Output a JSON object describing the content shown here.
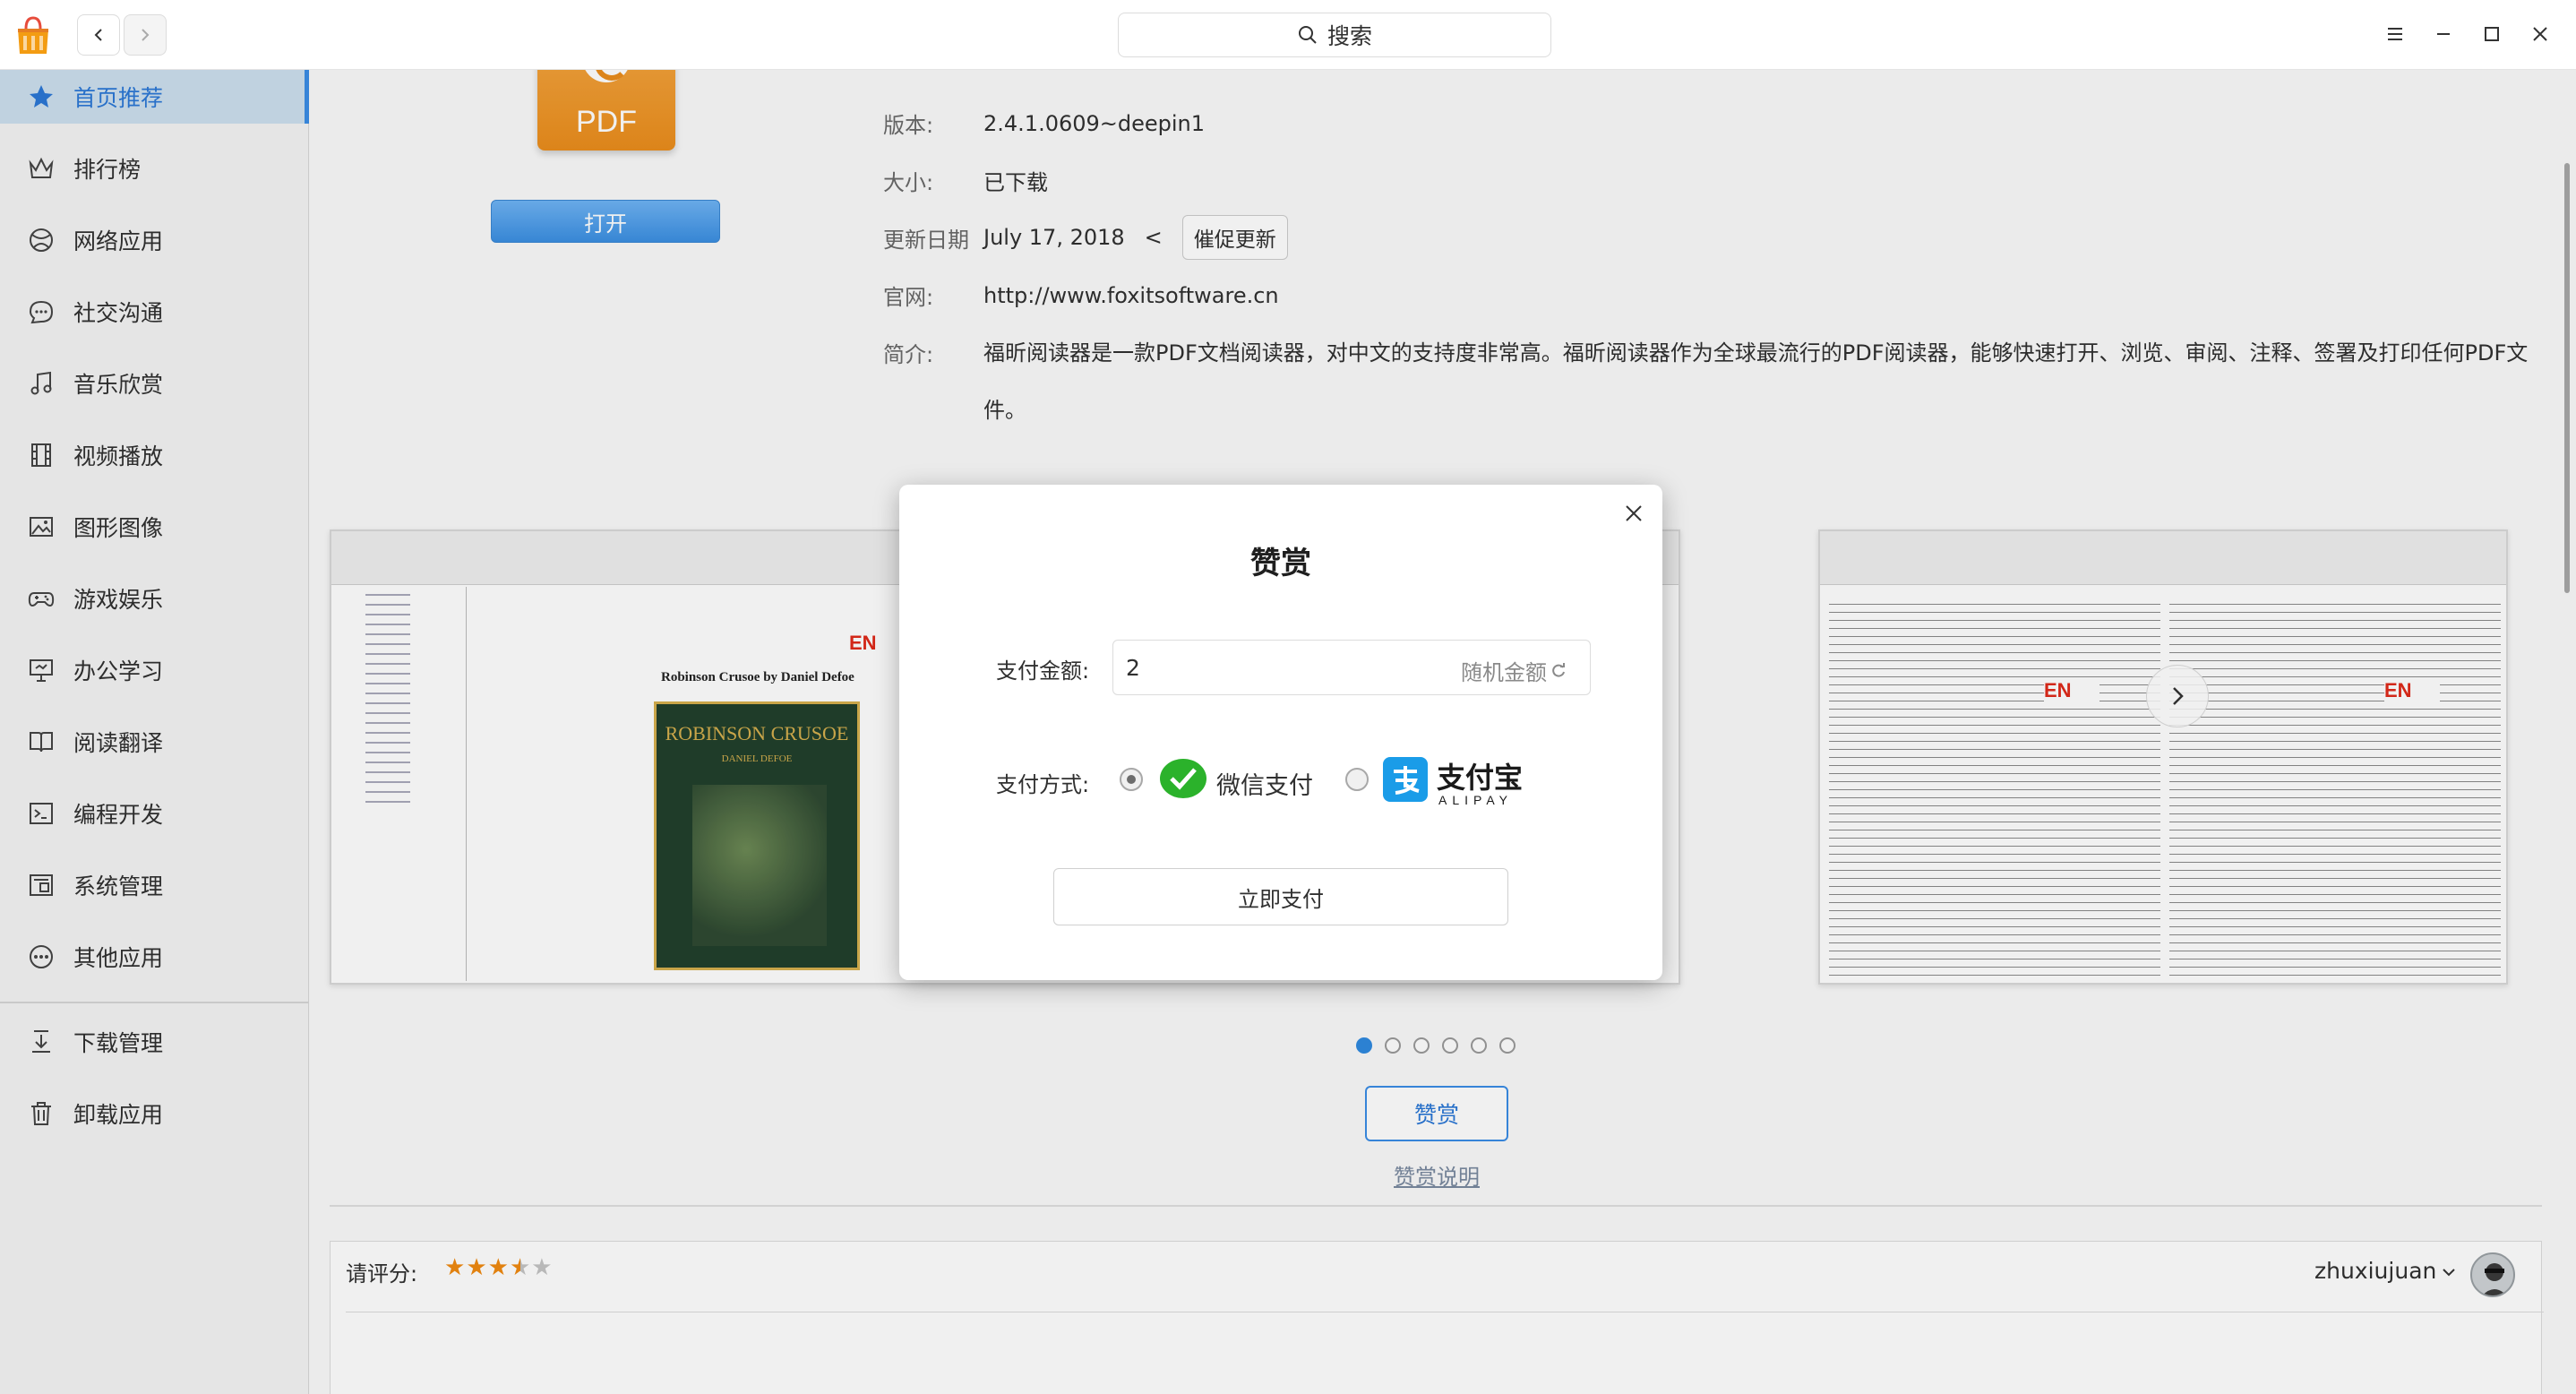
{
  "titlebar": {
    "search_label": "搜索"
  },
  "sidebar": {
    "items": [
      {
        "label": "首页推荐",
        "icon": "star-icon",
        "active": true
      },
      {
        "label": "排行榜",
        "icon": "crown-icon"
      },
      {
        "label": "网络应用",
        "icon": "globe-icon"
      },
      {
        "label": "社交沟通",
        "icon": "chat-icon"
      },
      {
        "label": "音乐欣赏",
        "icon": "music-icon"
      },
      {
        "label": "视频播放",
        "icon": "film-icon"
      },
      {
        "label": "图形图像",
        "icon": "image-icon"
      },
      {
        "label": "游戏娱乐",
        "icon": "gamepad-icon"
      },
      {
        "label": "办公学习",
        "icon": "presentation-icon"
      },
      {
        "label": "阅读翻译",
        "icon": "book-icon"
      },
      {
        "label": "编程开发",
        "icon": "terminal-icon"
      },
      {
        "label": "系统管理",
        "icon": "system-icon"
      },
      {
        "label": "其他应用",
        "icon": "more-icon"
      }
    ],
    "bottom_items": [
      {
        "label": "下载管理",
        "icon": "download-icon"
      },
      {
        "label": "卸载应用",
        "icon": "trash-icon"
      }
    ]
  },
  "app": {
    "icon_text": "PDF",
    "open_label": "打开",
    "version_label": "版本:",
    "version_value": "2.4.1.0609~deepin1",
    "size_label": "大小:",
    "size_value": "已下载",
    "update_label": "更新日期",
    "update_value": "July 17, 2018",
    "update_sep": "<",
    "urge_label": "催促更新",
    "site_label": "官网:",
    "site_value": "http://www.foxitsoftware.cn",
    "desc_label": "简介:",
    "desc_value": "福昕阅读器是一款PDF文档阅读器，对中文的支持度非常高。福昕阅读器作为全球最流行的PDF阅读器，能够快速打开、浏览、审阅、注释、签署及打印任何PDF文件。"
  },
  "screenshot": {
    "book_title": "Robinson Crusoe by Daniel Defoe",
    "cover_title": "ROBINSON CRUSOE",
    "cover_author": "DANIEL DEFOE",
    "logo_text": "EN"
  },
  "carousel": {
    "dot_count": 6,
    "active_index": 0
  },
  "reward": {
    "button_label": "赞赏",
    "help_label": "赞赏说明"
  },
  "rating": {
    "label": "请评分:",
    "stars": 3.5,
    "max": 5,
    "user": "zhuxiujuan"
  },
  "dialog": {
    "title": "赞赏",
    "amount_label": "支付金额:",
    "amount_value": "2",
    "random_label": "随机金额",
    "method_label": "支付方式:",
    "wechat_label": "微信支付",
    "alipay_label": "支付宝",
    "alipay_sub": "ALIPAY",
    "pay_label": "立即支付",
    "selected_method": "wechat"
  },
  "colors": {
    "accent": "#2f8ae0",
    "active_bg": "#cde0ef",
    "pdf_orange": "#ea8d1c",
    "wechat_green": "#2bb22b",
    "alipay_blue": "#1a9ce8",
    "star_on": "#f08a10"
  }
}
